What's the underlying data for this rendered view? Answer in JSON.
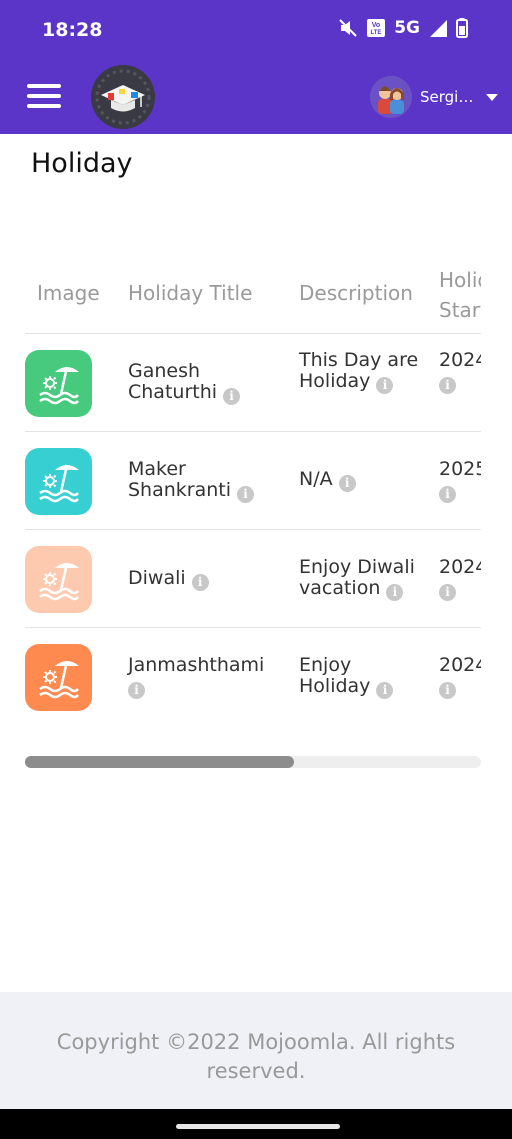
{
  "status_bar": {
    "time": "18:28",
    "network": "5G",
    "icons": [
      "mute-icon",
      "volte-icon",
      "signal-icon",
      "battery-icon"
    ],
    "volte_label": "Vo LTE"
  },
  "app_bar": {
    "user_name": "Sergio Alvarado",
    "background_color": "#5a35c8"
  },
  "page": {
    "title": "Holiday"
  },
  "table": {
    "headers": [
      "Image",
      "Holiday Title",
      "Description",
      "Holiday Start"
    ],
    "rows": [
      {
        "icon_color": "#47c97e",
        "title": "Ganesh Chaturthi",
        "description": "This Day are Holiday",
        "start": "2024"
      },
      {
        "icon_color": "#38cfd3",
        "title": "Maker Shankranti",
        "description": "N/A",
        "start": "2025"
      },
      {
        "icon_color": "#fdcab0",
        "title": "Diwali",
        "description": "Enjoy Diwali vacation",
        "start": "2024"
      },
      {
        "icon_color": "#ff8a50",
        "title": "Janmashthami",
        "description": "Enjoy Holiday",
        "start": "2024"
      }
    ],
    "info_glyph": "i"
  },
  "scrollbar": {
    "position_fraction": 0.0,
    "visible_fraction": 0.59
  },
  "footer": {
    "copyright": "Copyright ©2022 Mojoomla. All rights reserved."
  }
}
